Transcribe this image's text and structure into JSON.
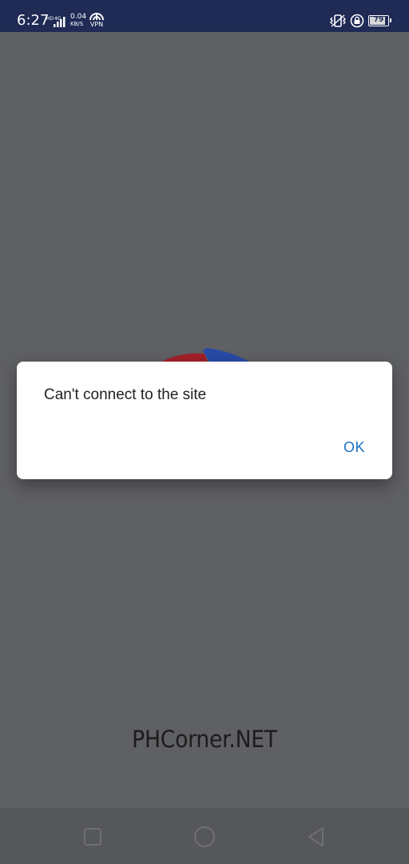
{
  "status_bar": {
    "time": "6:27",
    "network_hd": "HD",
    "network_type": "4G",
    "speed_value": "0.04",
    "speed_unit": "KB/S",
    "vpn_label": "VPN",
    "battery_level": "79",
    "icons": [
      "signal-icon",
      "vpn-icon",
      "vibrate-icon",
      "rotation-lock-icon",
      "battery-icon"
    ]
  },
  "dialog": {
    "message": "Can't connect to the site",
    "ok_label": "OK"
  },
  "watermark": {
    "text": "PHCorner.NET"
  },
  "nav_bar": {
    "icons": [
      "recents-icon",
      "home-icon",
      "back-icon"
    ]
  },
  "colors": {
    "status_bar": "#1f2a55",
    "scrim": "#5f6063",
    "dialog_bg": "#ffffff",
    "accent": "#1a6fc4",
    "logo_red": "#a3202a",
    "logo_blue": "#2a4aa8"
  }
}
